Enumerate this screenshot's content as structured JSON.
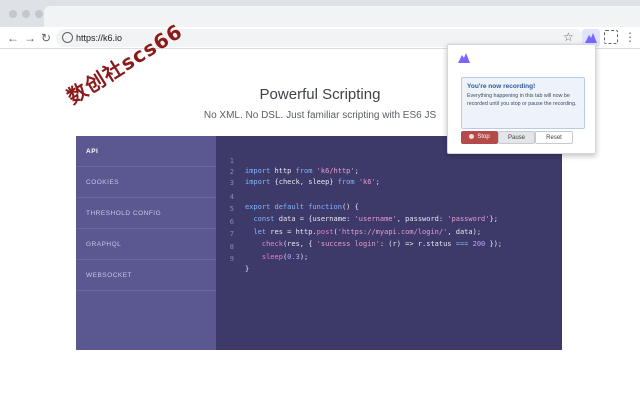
{
  "browser": {
    "url": "https://k6.io",
    "star_icon": "star-icon",
    "menu_icon": "menu-dots-icon"
  },
  "watermark": {
    "text": "数创社scs66"
  },
  "hero": {
    "title": "Powerful Scripting",
    "subtitle": "No XML. No DSL. Just familiar scripting with ES6 JS"
  },
  "sidebar": {
    "items": [
      {
        "label": "API",
        "active": true
      },
      {
        "label": "COOKIES",
        "active": false
      },
      {
        "label": "THRESHOLD CONFIG",
        "active": false
      },
      {
        "label": "GRAPHQL",
        "active": false
      },
      {
        "label": "WEBSOCKET",
        "active": false
      }
    ]
  },
  "code": {
    "line_numbers": [
      "1",
      "2",
      "3",
      "4",
      "5",
      "6",
      "7",
      "8",
      "9"
    ],
    "l1": {
      "kw1": "import",
      "t1": " http ",
      "kw2": "from",
      "t2": " ",
      "s1": "'k6/http'",
      "t3": ";"
    },
    "l2": {
      "kw1": "import",
      "t1": " {check, sleep} ",
      "kw2": "from",
      "t2": " ",
      "s1": "'k6'",
      "t3": ";"
    },
    "l4": {
      "kw1": "export default function",
      "t1": "() {"
    },
    "l5": {
      "kw1": "const",
      "t1": " data = {username: ",
      "s1": "'username'",
      "t2": ", password: ",
      "s2": "'password'",
      "t3": "};"
    },
    "l6": {
      "kw1": "let",
      "t1": " res = http.",
      "f1": "post",
      "t2": "(",
      "s1": "'https://myapi.com/login/'",
      "t3": ", data);"
    },
    "l7": {
      "f1": "check",
      "t1": "(res, { ",
      "s1": "'success login'",
      "t2": ": (r) => r.status ",
      "k1": "===",
      "t3": " ",
      "n1": "200",
      "t4": " });"
    },
    "l8": {
      "f1": "sleep",
      "t1": "(",
      "n1": "0.3",
      "t2": ");"
    },
    "l9": {
      "t1": "}"
    }
  },
  "popup": {
    "notice_title": "You're now recording!",
    "notice_body": "Everything happening in this tab will now be recorded until you stop or pause the recording.",
    "stop_label": "Stop",
    "pause_label": "Pause",
    "reset_label": "Reset",
    "stop_color": "#b54a4a"
  }
}
